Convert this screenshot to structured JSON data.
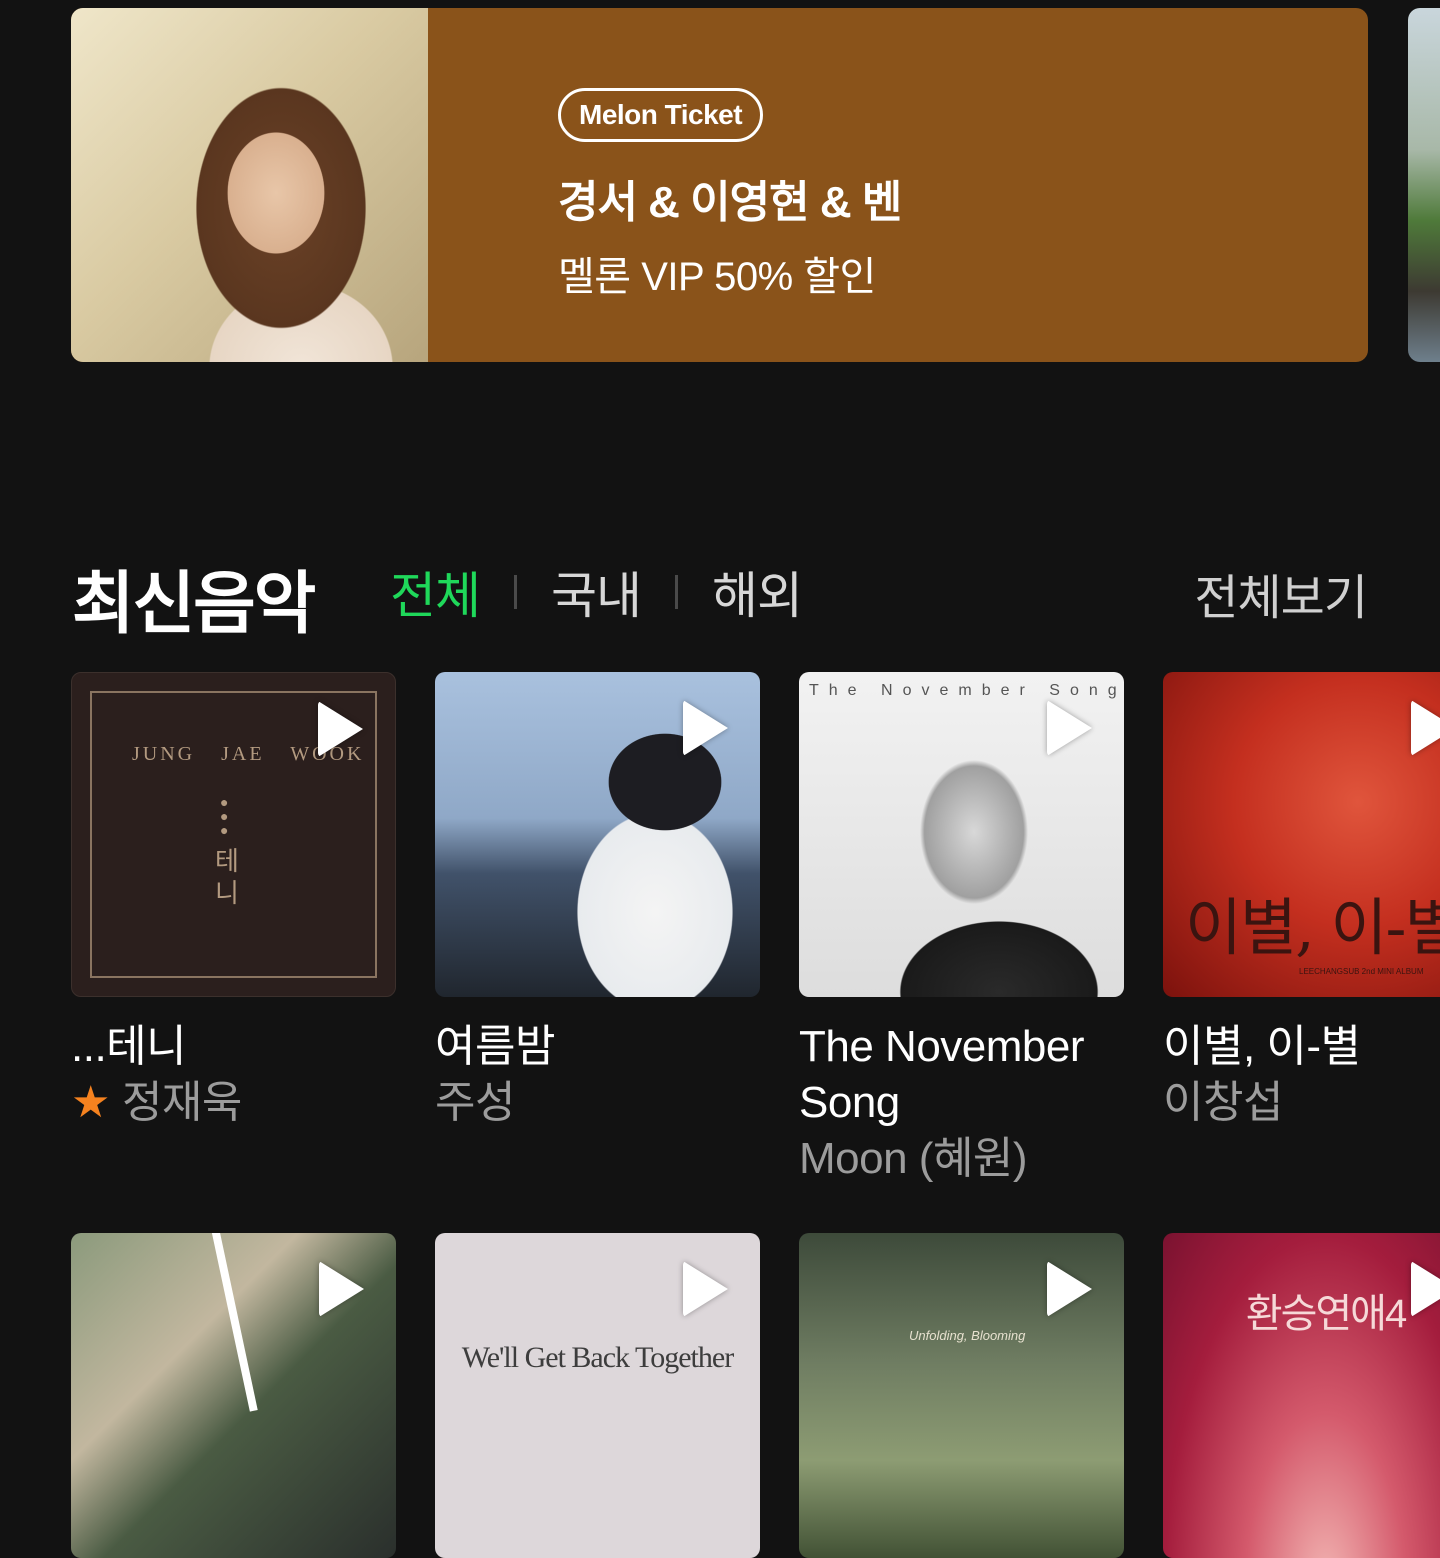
{
  "banner": {
    "pill": "Melon Ticket",
    "title": "경서 & 이영현 & 벤",
    "subtitle": "멜론 VIP 50% 할인"
  },
  "section": {
    "title": "최신음악",
    "tabs": [
      "전체",
      "국내",
      "해외"
    ],
    "active_tab": "전체",
    "view_all": "전체보기"
  },
  "albums_row1": [
    {
      "title": "...테니",
      "artist": "정재욱",
      "starred": true,
      "cover_text": "JUNG JAE WOOK",
      "cover_vertical": "테\n니"
    },
    {
      "title": "여름밤",
      "artist": "주성"
    },
    {
      "title": "The November Song",
      "artist": "Moon (혜원)",
      "cover_text": "The November Song"
    },
    {
      "title": "이별, 이-별",
      "artist": "이창섭",
      "cover_text": "이별, 이-별",
      "cover_small": "LEECHANGSUB 2nd MINI ALBUM"
    }
  ],
  "albums_row2": [
    {
      "cover_text": ""
    },
    {
      "cover_text": "We'll Get Back Together"
    },
    {
      "cover_text": "Unfolding, Blooming"
    },
    {
      "cover_text": "환승연애4"
    }
  ],
  "colors": {
    "accent_green": "#1fd85a",
    "banner_bg": "#8a531a",
    "star": "#f5821f",
    "background": "#121212"
  }
}
